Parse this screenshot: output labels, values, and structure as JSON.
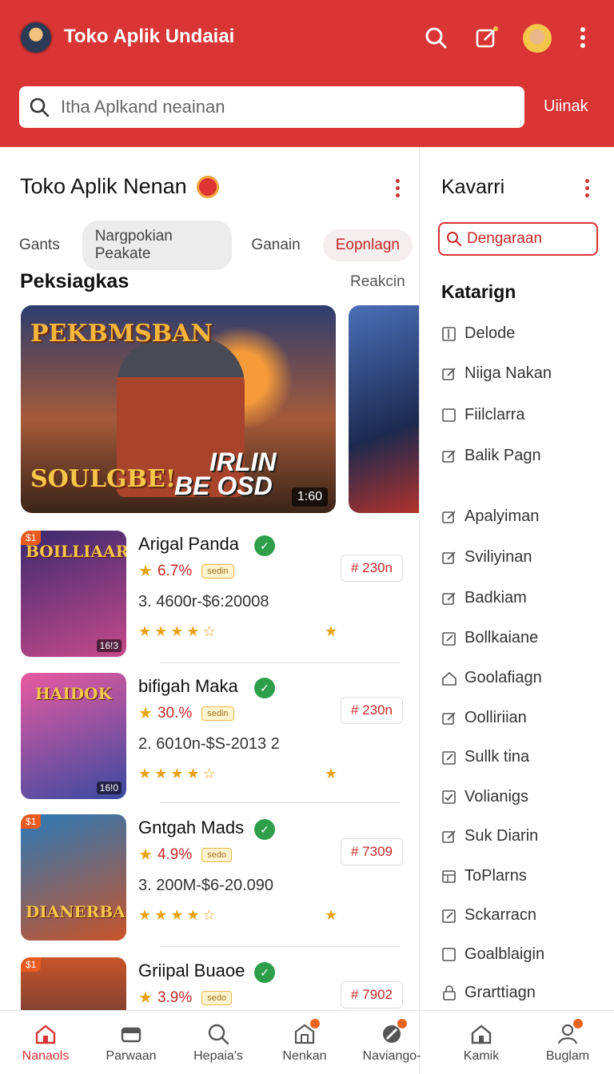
{
  "header": {
    "title": "Toko Aplik Undaiai",
    "search_placeholder": "Itha Aplkand neainan",
    "search_action": "Uiinak",
    "icons": [
      "search-icon",
      "edit-icon",
      "avatar",
      "more-vert-icon"
    ]
  },
  "main": {
    "title": "Toko Aplik Nenan",
    "chips": [
      "Gants",
      "Nargpokian Peakate",
      "Ganain",
      "Eopnlagn"
    ],
    "section_title": "Peksiagkas",
    "section_link": "Reakcin",
    "banner": {
      "top_text": "PEKBMSBAN",
      "bottom_text": "SOULGBE!",
      "big_line1": "IRLIN",
      "big_line2": "BE OSD",
      "duration": "1:60"
    },
    "apps": [
      {
        "name": "Arigal Panda",
        "rating": "6.7%",
        "badge": "sedin",
        "meta": "3. 4600r-$6:20008",
        "price": "# 230n",
        "thumb_title": "BOILLIAAR",
        "thumb_tag": "$1",
        "thumb_badge": "16!3",
        "stars": "★★★★☆",
        "thumb_colors": [
          "#3a2a6e",
          "#c64a8a"
        ]
      },
      {
        "name": "bifigah Maka",
        "rating": "30.%",
        "badge": "sedin",
        "meta": "2. 6010n-$S-2013 2",
        "price": "# 230n",
        "thumb_title": "HAIDOK",
        "thumb_tag": "",
        "thumb_badge": "16!0",
        "stars": "★★★★☆",
        "thumb_colors": [
          "#e85aa0",
          "#3a4aa0"
        ]
      },
      {
        "name": "Gntgah Mads",
        "rating": "4.9%",
        "badge": "sedo",
        "meta": "3. 200M-$6-20.090",
        "price": "# 7309",
        "thumb_title": "DIANERBAN",
        "thumb_tag": "$1",
        "thumb_badge": "",
        "stars": "★★★★☆",
        "thumb_colors": [
          "#2a7ab8",
          "#c8542a"
        ]
      },
      {
        "name": "Griipal Buaoe",
        "rating": "3.9%",
        "badge": "sedo",
        "meta": "",
        "price": "# 7902",
        "thumb_title": "",
        "thumb_tag": "$1",
        "thumb_badge": "",
        "stars": "",
        "thumb_colors": [
          "#c8542a",
          "#2a2a3a"
        ]
      }
    ]
  },
  "panel": {
    "title": "Kavarri",
    "search_label": "Dengaraan",
    "categories_title": "Katarign",
    "categories": [
      {
        "label": "Delode",
        "icon": "book-icon"
      },
      {
        "label": "Niiga Nakan",
        "icon": "edit-icon"
      },
      {
        "label": "Fiilclarra",
        "icon": "square-icon"
      },
      {
        "label": "Balik Pagn",
        "icon": "edit-icon"
      },
      {
        "label": "Apalyiman",
        "icon": "edit-icon"
      },
      {
        "label": "Sviliyinan",
        "icon": "edit-icon"
      },
      {
        "label": "Badkiam",
        "icon": "edit-icon"
      },
      {
        "label": "Bollkaiane",
        "icon": "edit-square-icon"
      },
      {
        "label": "Goolafiagn",
        "icon": "home-icon"
      },
      {
        "label": "Oolliriian",
        "icon": "edit-icon"
      },
      {
        "label": "Sullk tina",
        "icon": "edit-square-icon"
      },
      {
        "label": "Volianigs",
        "icon": "check-square-icon"
      },
      {
        "label": "Suk Diarin",
        "icon": "edit-icon"
      },
      {
        "label": "ToPlarns",
        "icon": "grid-icon"
      },
      {
        "label": "Sckarracn",
        "icon": "edit-square-icon"
      },
      {
        "label": "Goalblaigin",
        "icon": "square-icon"
      },
      {
        "label": "Grarttiagn",
        "icon": "lock-icon"
      }
    ]
  },
  "bottom_nav": [
    {
      "label": "Nanaols",
      "icon": "home-icon",
      "active": true,
      "dot": false
    },
    {
      "label": "Parwaan",
      "icon": "wallet-icon",
      "active": false,
      "dot": false
    },
    {
      "label": "Hepaia's",
      "icon": "search-icon",
      "active": false,
      "dot": false
    },
    {
      "label": "Nenkan",
      "icon": "store-icon",
      "active": false,
      "dot": true
    },
    {
      "label": "Naviango-",
      "icon": "compass-icon",
      "active": false,
      "dot": true
    },
    {
      "label": "Kamik",
      "icon": "home-icon",
      "active": false,
      "dot": false
    },
    {
      "label": "Buglam",
      "icon": "user-icon",
      "active": false,
      "dot": true
    }
  ],
  "colors": {
    "brand": "#d93535",
    "accent_star": "#e8a21a",
    "verified": "#2e9e4a"
  }
}
